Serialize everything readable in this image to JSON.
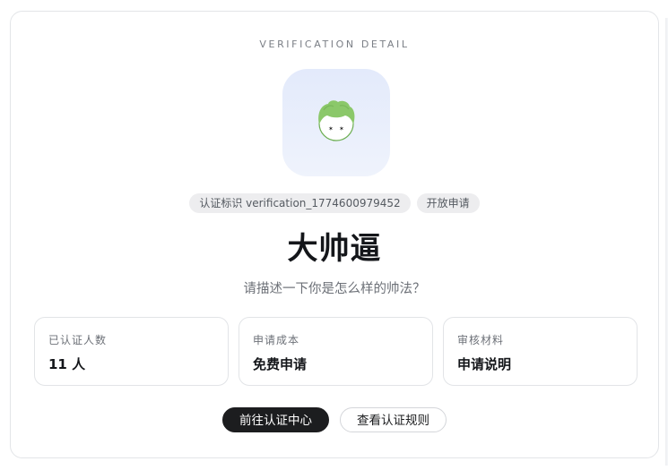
{
  "header": {
    "eyebrow": "VERIFICATION DETAIL"
  },
  "avatar": {
    "icon": "cartoon-boy-avatar",
    "hair_color": "#8bc86a",
    "background": "#e6ecfb"
  },
  "tags": {
    "verification_id": "认证标识 verification_1774600979452",
    "status": "开放申请"
  },
  "title": "大帅逼",
  "subtitle": "请描述一下你是怎么样的帅法？",
  "stats": [
    {
      "label": "已认证人数",
      "value": "11 人"
    },
    {
      "label": "申请成本",
      "value": "免费申请"
    },
    {
      "label": "审核材料",
      "value": "申请说明"
    }
  ],
  "actions": {
    "primary_label": "前往认证中心",
    "secondary_label": "查看认证规则"
  },
  "colors": {
    "primary_button": "#1c1d1f",
    "tag_background": "#ededef",
    "card_border": "#e3e5e8"
  }
}
